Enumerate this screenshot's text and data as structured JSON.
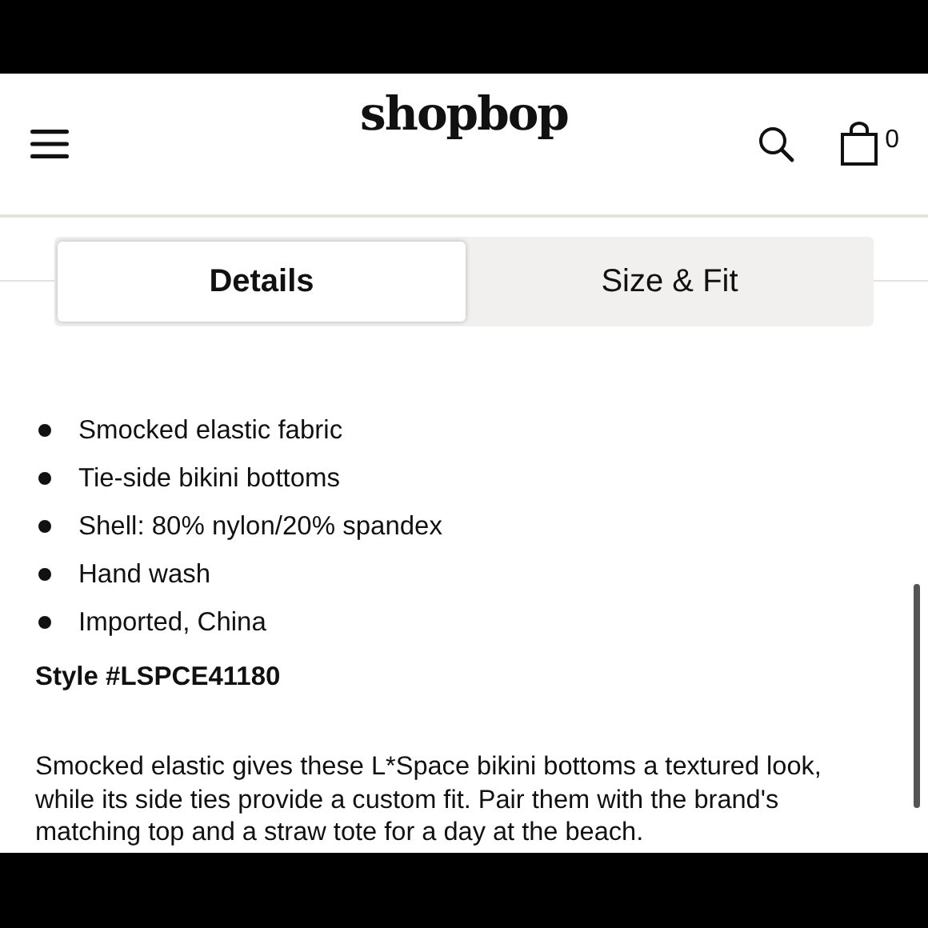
{
  "header": {
    "logo": "shopbop",
    "cart_count": "0"
  },
  "tabs": [
    {
      "label": "Details",
      "selected": true
    },
    {
      "label": "Size & Fit",
      "selected": false
    }
  ],
  "details": [
    "Smocked elastic fabric",
    "Tie-side bikini bottoms",
    "Shell: 80% nylon/20% spandex",
    "Hand wash",
    "Imported, China"
  ],
  "style_number": "Style #LSPCE41180",
  "description": "Smocked elastic gives these L*Space bikini bottoms a textured look, while its side ties provide a custom fit. Pair them with the brand's matching top and a straw tote for a day at the beach."
}
